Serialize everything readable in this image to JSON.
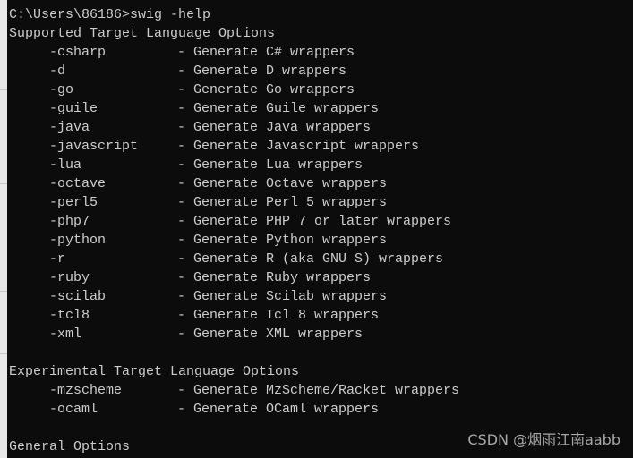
{
  "prompt": "C:\\Users\\86186>swig -help",
  "sections": [
    {
      "heading": "Supported Target Language Options",
      "options": [
        {
          "flag": "-csharp",
          "desc": "- Generate C# wrappers"
        },
        {
          "flag": "-d",
          "desc": "- Generate D wrappers"
        },
        {
          "flag": "-go",
          "desc": "- Generate Go wrappers"
        },
        {
          "flag": "-guile",
          "desc": "- Generate Guile wrappers"
        },
        {
          "flag": "-java",
          "desc": "- Generate Java wrappers"
        },
        {
          "flag": "-javascript",
          "desc": "- Generate Javascript wrappers"
        },
        {
          "flag": "-lua",
          "desc": "- Generate Lua wrappers"
        },
        {
          "flag": "-octave",
          "desc": "- Generate Octave wrappers"
        },
        {
          "flag": "-perl5",
          "desc": "- Generate Perl 5 wrappers"
        },
        {
          "flag": "-php7",
          "desc": "- Generate PHP 7 or later wrappers"
        },
        {
          "flag": "-python",
          "desc": "- Generate Python wrappers"
        },
        {
          "flag": "-r",
          "desc": "- Generate R (aka GNU S) wrappers"
        },
        {
          "flag": "-ruby",
          "desc": "- Generate Ruby wrappers"
        },
        {
          "flag": "-scilab",
          "desc": "- Generate Scilab wrappers"
        },
        {
          "flag": "-tcl8",
          "desc": "- Generate Tcl 8 wrappers"
        },
        {
          "flag": "-xml",
          "desc": "- Generate XML wrappers"
        }
      ]
    },
    {
      "heading": "Experimental Target Language Options",
      "options": [
        {
          "flag": "-mzscheme",
          "desc": "- Generate MzScheme/Racket wrappers"
        },
        {
          "flag": "-ocaml",
          "desc": "- Generate OCaml wrappers"
        }
      ]
    },
    {
      "heading": "General Options",
      "options": []
    }
  ],
  "watermark": "CSDN @烟雨江南aabb"
}
